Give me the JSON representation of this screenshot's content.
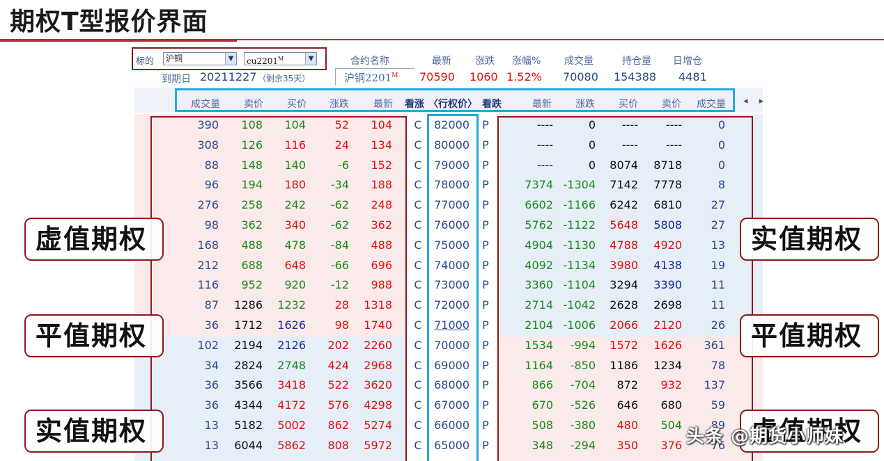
{
  "page": {
    "title": "期权T型报价界面"
  },
  "selector": {
    "label": "标的",
    "underlying": "沪铜",
    "contract": "cu2201",
    "contract_sup": "M"
  },
  "info": {
    "headers": [
      "合约名称",
      "最新",
      "涨跌",
      "涨幅%",
      "成交量",
      "持仓量",
      "日增仓"
    ],
    "expiry_label": "到期日",
    "expiry_date": "20211227",
    "remaining": "（剩余35天）",
    "contract_name": "沪铜2201",
    "contract_name_sup": "M",
    "last": "70590",
    "change": "1060",
    "pct": "1.52%",
    "volume": "70080",
    "open_interest": "154388",
    "daily_oi_change": "4481"
  },
  "table": {
    "call_headers": [
      "成交量",
      "卖价",
      "买价",
      "涨跌",
      "最新"
    ],
    "mid_headers": [
      "看涨",
      "〈行权价〉",
      "看跌"
    ],
    "put_headers": [
      "最新",
      "涨跌",
      "买价",
      "卖价",
      "成交量"
    ],
    "nav": "◂ ▸",
    "rows": [
      {
        "cv": "390",
        "cs": "108",
        "cb": "104",
        "cc": "52",
        "cl": "104",
        "k": "82000",
        "pl": "----",
        "pc": "0",
        "pb": "----",
        "ps": "----",
        "pv": "0"
      },
      {
        "cv": "308",
        "cs": "126",
        "cb": "116",
        "cc": "24",
        "cl": "134",
        "k": "80000",
        "pl": "----",
        "pc": "0",
        "pb": "----",
        "ps": "----",
        "pv": "0"
      },
      {
        "cv": "88",
        "cs": "148",
        "cb": "140",
        "cc": "-6",
        "cl": "152",
        "k": "79000",
        "pl": "----",
        "pc": "0",
        "pb": "8074",
        "ps": "8718",
        "pv": "0"
      },
      {
        "cv": "96",
        "cs": "194",
        "cb": "180",
        "cc": "-34",
        "cl": "188",
        "k": "78000",
        "pl": "7374",
        "pc": "-1304",
        "pb": "7142",
        "ps": "7778",
        "pv": "8"
      },
      {
        "cv": "276",
        "cs": "258",
        "cb": "242",
        "cc": "-62",
        "cl": "248",
        "k": "77000",
        "pl": "6602",
        "pc": "-1166",
        "pb": "6242",
        "ps": "6810",
        "pv": "27"
      },
      {
        "cv": "98",
        "cs": "362",
        "cb": "340",
        "cc": "-62",
        "cl": "362",
        "k": "76000",
        "pl": "5762",
        "pc": "-1122",
        "pb": "5648",
        "ps": "5808",
        "pv": "27"
      },
      {
        "cv": "168",
        "cs": "488",
        "cb": "478",
        "cc": "-84",
        "cl": "488",
        "k": "75000",
        "pl": "4904",
        "pc": "-1130",
        "pb": "4788",
        "ps": "4920",
        "pv": "13"
      },
      {
        "cv": "212",
        "cs": "688",
        "cb": "648",
        "cc": "-66",
        "cl": "696",
        "k": "74000",
        "pl": "4092",
        "pc": "-1134",
        "pb": "3980",
        "ps": "4138",
        "pv": "19"
      },
      {
        "cv": "116",
        "cs": "952",
        "cb": "920",
        "cc": "-12",
        "cl": "988",
        "k": "73000",
        "pl": "3360",
        "pc": "-1104",
        "pb": "3294",
        "ps": "3390",
        "pv": "11"
      },
      {
        "cv": "87",
        "cs": "1286",
        "cb": "1232",
        "cc": "28",
        "cl": "1318",
        "k": "72000",
        "pl": "2714",
        "pc": "-1042",
        "pb": "2628",
        "ps": "2698",
        "pv": "11"
      },
      {
        "cv": "36",
        "cs": "1712",
        "cb": "1626",
        "cc": "98",
        "cl": "1740",
        "k": "71000",
        "pl": "2104",
        "pc": "-1006",
        "pb": "2066",
        "ps": "2120",
        "pv": "26"
      },
      {
        "cv": "102",
        "cs": "2194",
        "cb": "2126",
        "cc": "202",
        "cl": "2260",
        "k": "70000",
        "pl": "1534",
        "pc": "-994",
        "pb": "1572",
        "ps": "1626",
        "pv": "361"
      },
      {
        "cv": "34",
        "cs": "2824",
        "cb": "2748",
        "cc": "424",
        "cl": "2968",
        "k": "69000",
        "pl": "1164",
        "pc": "-850",
        "pb": "1186",
        "ps": "1234",
        "pv": "78"
      },
      {
        "cv": "36",
        "cs": "3566",
        "cb": "3418",
        "cc": "522",
        "cl": "3620",
        "k": "68000",
        "pl": "866",
        "pc": "-704",
        "pb": "872",
        "ps": "932",
        "pv": "137"
      },
      {
        "cv": "36",
        "cs": "4344",
        "cb": "4172",
        "cc": "576",
        "cl": "4298",
        "k": "67000",
        "pl": "670",
        "pc": "-526",
        "pb": "646",
        "ps": "680",
        "pv": "59"
      },
      {
        "cv": "13",
        "cs": "5182",
        "cb": "5002",
        "cc": "862",
        "cl": "5274",
        "k": "66000",
        "pl": "508",
        "pc": "-380",
        "pb": "480",
        "ps": "504",
        "pv": "89"
      },
      {
        "cv": "13",
        "cs": "6044",
        "cb": "5862",
        "cc": "808",
        "cl": "5972",
        "k": "65000",
        "pl": "348",
        "pc": "-294",
        "pb": "350",
        "ps": "376",
        "pv": "76"
      }
    ],
    "call_label": "C",
    "put_label": "P",
    "atm_strike": "71000"
  },
  "badges": {
    "left_top": "虚值期权",
    "left_mid": "平值期权",
    "left_bot": "实值期权",
    "right_top": "实值期权",
    "right_mid": "平值期权",
    "right_bot": "虚值期权"
  },
  "watermark": "头条 @期货小师妹",
  "colors": {
    "up": "#e01010",
    "down": "#1a8a1a",
    "neutral": "#111111",
    "bid_low": "#1a2aa0",
    "volume": "#2a4a8a",
    "frame_red": "#8b1a1a",
    "frame_blue": "#26a8e0"
  }
}
